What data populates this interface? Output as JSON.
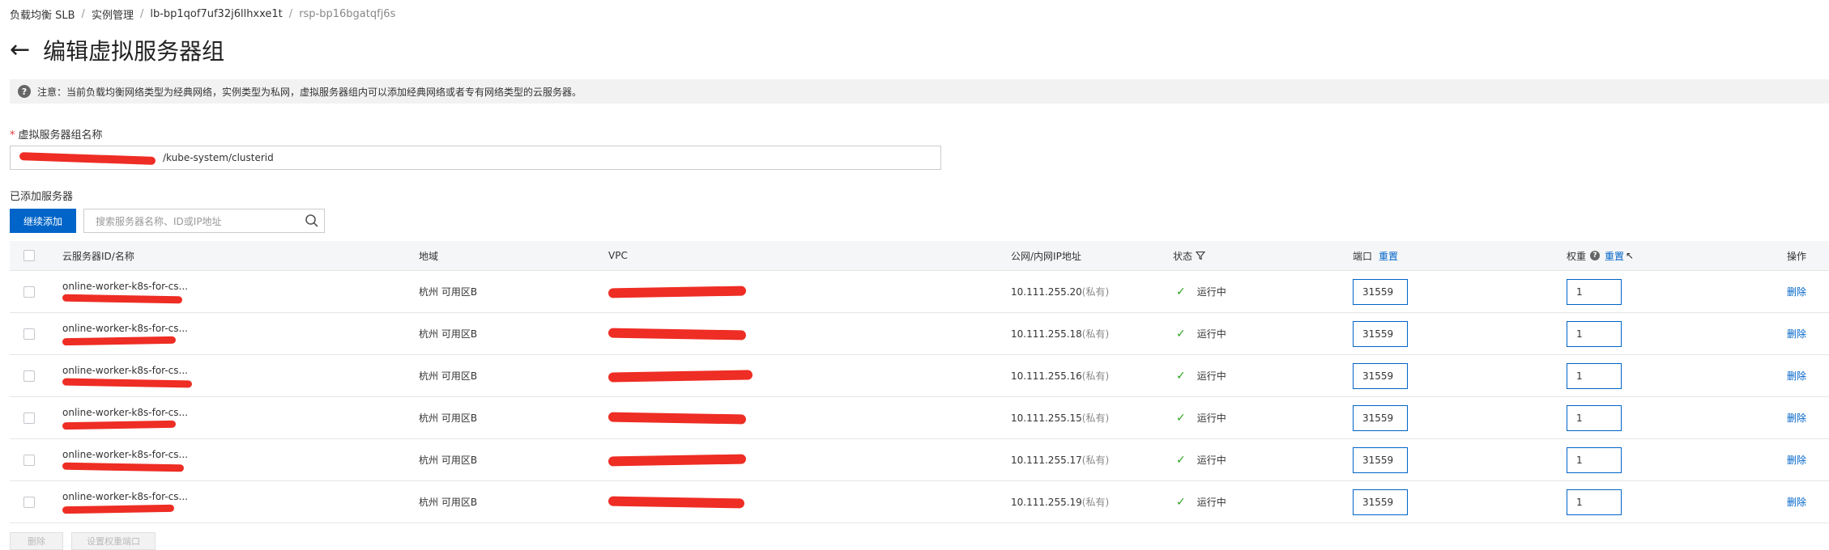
{
  "breadcrumb": {
    "items": [
      "负载均衡 SLB",
      "实例管理",
      "lb-bp1qof7uf32j6llhxxe1t"
    ],
    "current": "rsp-bp16bgatqfj6s",
    "separator": "/"
  },
  "header": {
    "back_icon": "arrow-left-icon",
    "title": "编辑虚拟服务器组"
  },
  "notice": {
    "icon": "question-icon",
    "text": "注意：当前负载均衡网络类型为经典网络，实例类型为私网，虚拟服务器组内可以添加经典网络或者专有网络类型的云服务器。"
  },
  "form": {
    "name_label": "虚拟服务器组名称",
    "required_mark": "*",
    "name_value": "/kube-system/clusterid"
  },
  "servers": {
    "section_label": "已添加服务器",
    "add_button": "继续添加",
    "search_placeholder": "搜索服务器名称、ID或IP地址"
  },
  "table": {
    "headers": {
      "name": "云服务器ID/名称",
      "region": "地域",
      "vpc": "VPC",
      "ip": "公网/内网IP地址",
      "status": "状态",
      "port": "端口",
      "port_reset": "重置",
      "weight": "权重",
      "weight_reset": "重置",
      "action": "操作"
    },
    "rows": [
      {
        "name": "online-worker-k8s-for-cs...",
        "region": "杭州 可用区B",
        "ip": "10.111.255.20",
        "ip_type": "(私有)",
        "status": "运行中",
        "port": "31559",
        "weight": "1",
        "action": "删除"
      },
      {
        "name": "online-worker-k8s-for-cs...",
        "region": "杭州 可用区B",
        "ip": "10.111.255.18",
        "ip_type": "(私有)",
        "status": "运行中",
        "port": "31559",
        "weight": "1",
        "action": "删除"
      },
      {
        "name": "online-worker-k8s-for-cs...",
        "region": "杭州 可用区B",
        "ip": "10.111.255.16",
        "ip_type": "(私有)",
        "status": "运行中",
        "port": "31559",
        "weight": "1",
        "action": "删除"
      },
      {
        "name": "online-worker-k8s-for-cs...",
        "region": "杭州 可用区B",
        "ip": "10.111.255.15",
        "ip_type": "(私有)",
        "status": "运行中",
        "port": "31559",
        "weight": "1",
        "action": "删除"
      },
      {
        "name": "online-worker-k8s-for-cs...",
        "region": "杭州 可用区B",
        "ip": "10.111.255.17",
        "ip_type": "(私有)",
        "status": "运行中",
        "port": "31559",
        "weight": "1",
        "action": "删除"
      },
      {
        "name": "online-worker-k8s-for-cs...",
        "region": "杭州 可用区B",
        "ip": "10.111.255.19",
        "ip_type": "(私有)",
        "status": "运行中",
        "port": "31559",
        "weight": "1",
        "action": "删除"
      }
    ]
  },
  "footer": {
    "delete_button": "删除",
    "batch_button": "设置权重端口"
  },
  "colors": {
    "accent": "#0064c8",
    "success": "#2ea121",
    "redaction": "#ee2d24"
  }
}
